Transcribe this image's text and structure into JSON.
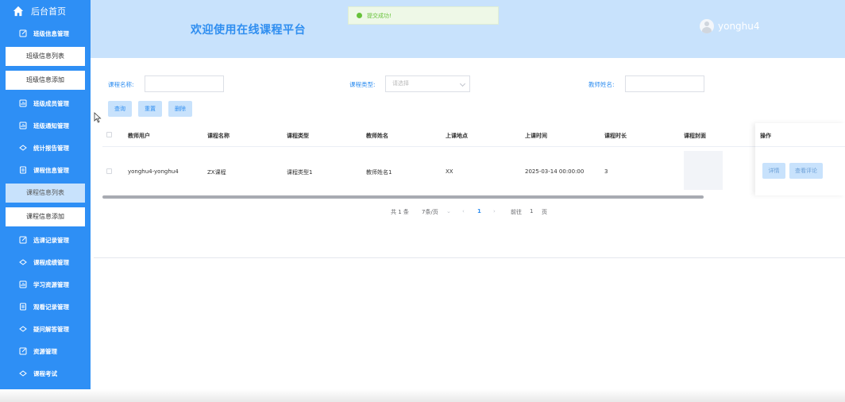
{
  "sidebar": {
    "home_label": "后台首页",
    "items": [
      {
        "type": "menu",
        "label": "班级信息管理",
        "icon": "edit-icon"
      },
      {
        "type": "sub",
        "label": "班级信息列表",
        "active": false
      },
      {
        "type": "sub",
        "label": "班级信息添加",
        "active": false
      },
      {
        "type": "menu",
        "label": "班级成员管理",
        "icon": "chart-icon"
      },
      {
        "type": "menu",
        "label": "班级通知管理",
        "icon": "chart-icon"
      },
      {
        "type": "menu",
        "label": "统计报告管理",
        "icon": "cloud-icon"
      },
      {
        "type": "menu",
        "label": "课程信息管理",
        "icon": "document-icon"
      },
      {
        "type": "sub",
        "label": "课程信息列表",
        "active": true
      },
      {
        "type": "sub",
        "label": "课程信息添加",
        "active": false
      },
      {
        "type": "menu",
        "label": "选课记录管理",
        "icon": "edit-icon"
      },
      {
        "type": "menu",
        "label": "课程成绩管理",
        "icon": "cloud-icon"
      },
      {
        "type": "menu",
        "label": "学习资源管理",
        "icon": "chart-icon"
      },
      {
        "type": "menu",
        "label": "观看记录管理",
        "icon": "document-icon"
      },
      {
        "type": "menu",
        "label": "疑问解答管理",
        "icon": "cloud-icon"
      },
      {
        "type": "menu",
        "label": "资源管理",
        "icon": "edit-icon"
      },
      {
        "type": "menu",
        "label": "课程考试",
        "icon": "cloud-icon"
      }
    ]
  },
  "header": {
    "title": "欢迎使用在线课程平台",
    "username": "yonghu4"
  },
  "toast": {
    "message": "提交成功!"
  },
  "search": {
    "course_name_label": "课程名称:",
    "course_name_value": "",
    "course_type_label": "课程类型:",
    "course_type_placeholder": "请选择",
    "teacher_name_label": "教师姓名:",
    "teacher_name_value": ""
  },
  "buttons": {
    "query": "查询",
    "reset": "重置",
    "delete": "删除"
  },
  "table": {
    "headers": [
      "教师用户",
      "课程名称",
      "课程类型",
      "教师姓名",
      "上课地点",
      "上课时间",
      "课程时长",
      "课程封面",
      "操作"
    ],
    "rows": [
      {
        "teacher_user": "yonghu4-yonghu4",
        "course_name": "ZX课程",
        "course_type": "课程类型1",
        "teacher_name": "教师姓名1",
        "location": "XX",
        "time": "2025-03-14 00:00:00",
        "duration": "3",
        "action_detail": "详情",
        "action_comments": "查看评论"
      }
    ]
  },
  "pagination": {
    "total": "共 1 条",
    "page_size": "7条/页",
    "current_page": "1",
    "goto_prefix": "前往",
    "goto_value": "1",
    "goto_suffix": "页"
  },
  "colors": {
    "sidebar": "#2e8ff5",
    "header": "#c8e2fc",
    "accent": "#2f8ef0",
    "success": "#67c23a"
  }
}
